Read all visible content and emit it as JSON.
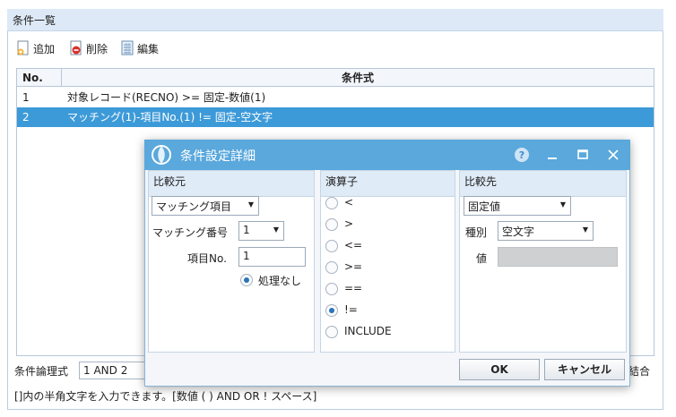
{
  "main": {
    "title": "条件一覧",
    "toolbar": {
      "add": "追加",
      "delete": "削除",
      "edit": "編集"
    },
    "grid": {
      "columns": [
        "No.",
        "条件式"
      ],
      "rows": [
        {
          "no": "1",
          "expr": "対象レコード(RECNO) >= 固定-数値(1)"
        },
        {
          "no": "2",
          "expr": "マッチング(1)-項目No.(1) != 固定-空文字"
        }
      ]
    },
    "logic_label": "条件論理式",
    "logic_value": "1 AND 2",
    "join_label": "結合",
    "hint": "[]内の半角文字を入力できます。[数値 ( ) AND OR ! スペース]"
  },
  "dialog": {
    "title": "条件設定詳細",
    "source": {
      "header": "比較元",
      "type_selected": "マッチング項目",
      "match_no_label": "マッチング番号",
      "match_no_value": "1",
      "item_no_label": "項目No.",
      "item_no_value": "1",
      "no_process_label": "処理なし"
    },
    "operator": {
      "header": "演算子",
      "options": [
        "<",
        ">",
        "<=",
        ">=",
        "==",
        "!=",
        "INCLUDE"
      ],
      "selected": "!="
    },
    "target": {
      "header": "比較先",
      "type_selected": "固定値",
      "kind_label": "種別",
      "kind_value": "空文字",
      "value_label": "値",
      "value": ""
    },
    "ok_label": "OK",
    "cancel_label": "キャンセル"
  }
}
